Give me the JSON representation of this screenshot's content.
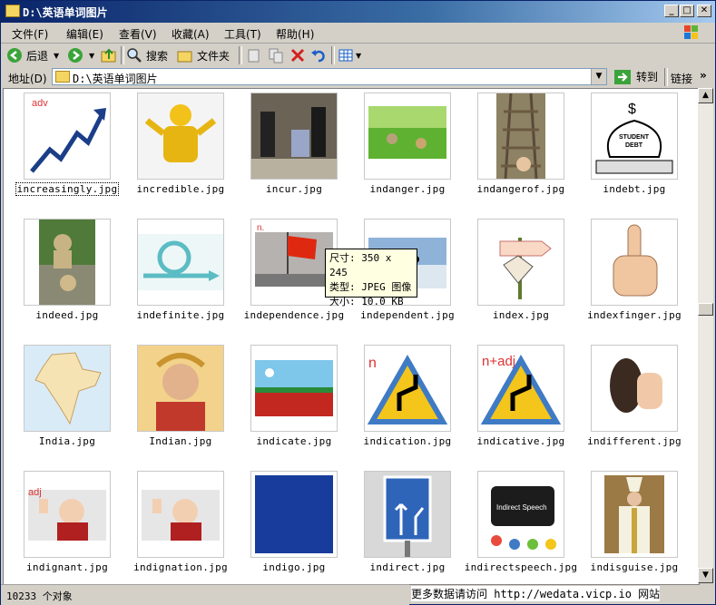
{
  "window": {
    "title": "D:\\英语单词图片"
  },
  "menu": {
    "items": [
      "文件(F)",
      "编辑(E)",
      "查看(V)",
      "收藏(A)",
      "工具(T)",
      "帮助(H)"
    ]
  },
  "toolbar": {
    "back_label": "后退",
    "search_label": "搜索",
    "folders_label": "文件夹"
  },
  "address": {
    "label": "地址(D)",
    "value": "D:\\英语单词图片",
    "go_label": "转到",
    "links_label": "链接"
  },
  "files": [
    {
      "name": "increasingly.jpg",
      "selected": true
    },
    {
      "name": "incredible.jpg"
    },
    {
      "name": "incur.jpg"
    },
    {
      "name": "indanger.jpg"
    },
    {
      "name": "indangerof.jpg"
    },
    {
      "name": "indebt.jpg"
    },
    {
      "name": "indeed.jpg"
    },
    {
      "name": "indefinite.jpg"
    },
    {
      "name": "independence.jpg"
    },
    {
      "name": "independent.jpg"
    },
    {
      "name": "index.jpg"
    },
    {
      "name": "indexfinger.jpg"
    },
    {
      "name": "India.jpg"
    },
    {
      "name": "Indian.jpg"
    },
    {
      "name": "indicate.jpg"
    },
    {
      "name": "indication.jpg"
    },
    {
      "name": "indicative.jpg"
    },
    {
      "name": "indifferent.jpg"
    },
    {
      "name": "indignant.jpg"
    },
    {
      "name": "indignation.jpg"
    },
    {
      "name": "indigo.jpg"
    },
    {
      "name": "indirect.jpg"
    },
    {
      "name": "indirectspeech.jpg"
    },
    {
      "name": "indisguise.jpg"
    }
  ],
  "thumb_text": {
    "increasingly": "adv",
    "indebt_line1": "STUDENT",
    "indebt_line2": "DEBT",
    "independence": "n.",
    "indication": "n",
    "indicative": "n+adj",
    "indignant": "adj",
    "indirectspeech": "Indirect Speech"
  },
  "tooltip": {
    "line1": "尺寸: 350 x 245",
    "line2": "类型: JPEG 图像",
    "line3": "大小: 10.0 KB"
  },
  "status": {
    "text": "10233 个对象"
  },
  "watermark": "更多数据请访问 http://wedata.vicp.io 网站"
}
